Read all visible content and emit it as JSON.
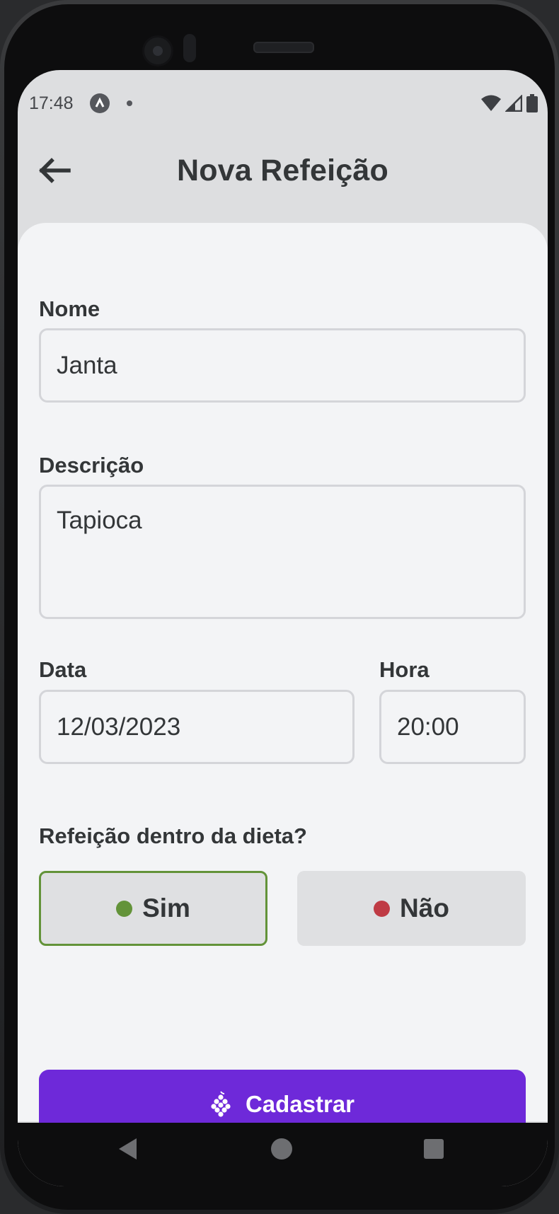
{
  "status_bar": {
    "time": "17:48",
    "icons": [
      "app-notification-icon",
      "dot-icon",
      "wifi-icon",
      "signal-icon",
      "battery-icon"
    ]
  },
  "header": {
    "title": "Nova Refeição",
    "back_icon": "arrow-left-icon"
  },
  "form": {
    "name": {
      "label": "Nome",
      "value": "Janta"
    },
    "description": {
      "label": "Descrição",
      "value": "Tapioca"
    },
    "date": {
      "label": "Data",
      "value": "12/03/2023"
    },
    "time": {
      "label": "Hora",
      "value": "20:00"
    },
    "diet_question": "Refeição dentro da dieta?",
    "options": [
      {
        "label": "Sim",
        "color": "#639339",
        "selected": true
      },
      {
        "label": "Não",
        "color": "#bf3b44",
        "selected": false
      }
    ],
    "submit": {
      "label": "Cadastrar",
      "icon": "grape-icon",
      "color": "#6e29d9"
    }
  },
  "nav_bar": {
    "icons": [
      "nav-back-icon",
      "nav-home-icon",
      "nav-recent-icon"
    ]
  }
}
